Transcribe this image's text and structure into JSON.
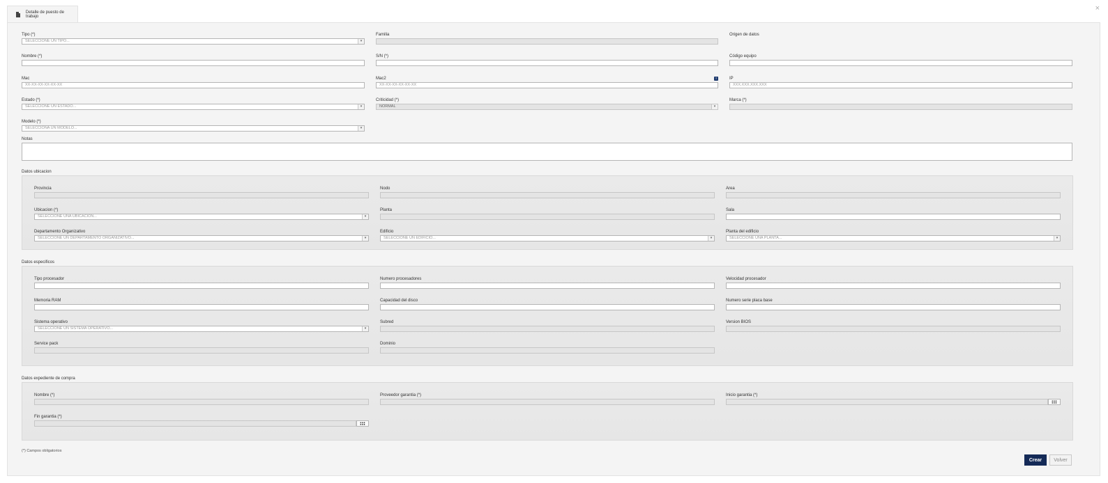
{
  "tab": {
    "title": "Detalle de puesto de trabajo",
    "icon": "document-icon"
  },
  "close_label": "×",
  "form": {
    "tipo": {
      "label": "Tipo (*)",
      "placeholder": "SELECCIONE UN TIPO..."
    },
    "familia": {
      "label": "Familia",
      "value": ""
    },
    "origen_datos": {
      "label": "Origen de datos"
    },
    "nombre": {
      "label": "Nombre (*)",
      "value": ""
    },
    "sn": {
      "label": "S/N (*)",
      "value": ""
    },
    "codigo_equipo": {
      "label": "Código equipo",
      "value": ""
    },
    "mac": {
      "label": "Mac",
      "placeholder": "XX-XX-XX-XX-XX-XX"
    },
    "mac2": {
      "label": "Mac2",
      "placeholder": "XX-XX-XX-XX-XX-XX",
      "info_icon": "info-icon"
    },
    "ip": {
      "label": "IP",
      "placeholder": "XXX.XXX.XXX.XXX"
    },
    "estado": {
      "label": "Estado (*)",
      "placeholder": "SELECCIONE UN ESTADO..."
    },
    "criticidad": {
      "label": "Criticidad (*)",
      "value": "NORMAL"
    },
    "marca": {
      "label": "Marca (*)",
      "value": ""
    },
    "modelo": {
      "label": "Modelo (*)",
      "placeholder": "SELECCIONA UN MODELO..."
    },
    "notas": {
      "label": "Notas",
      "value": ""
    }
  },
  "ubicacion": {
    "title": "Datos ubicacion",
    "provincia": {
      "label": "Provincia",
      "value": ""
    },
    "nodo": {
      "label": "Nodo",
      "value": ""
    },
    "area": {
      "label": "Area",
      "value": ""
    },
    "ubicacion": {
      "label": "Ubicacion (*)",
      "placeholder": "SELECCIONE UNA UBICACIÓN..."
    },
    "planta": {
      "label": "Planta",
      "value": ""
    },
    "sala": {
      "label": "Sala",
      "value": ""
    },
    "departamento": {
      "label": "Departamento Organizativo",
      "placeholder": "SELECCIONE UN DEPARTAMENTO ORGANIZATIVO..."
    },
    "edificio": {
      "label": "Edificio",
      "placeholder": "SELECCIONE UN EDIFICIO..."
    },
    "planta_edificio": {
      "label": "Planta del edificio",
      "placeholder": "SELECCIONE UNA PLANTA..."
    }
  },
  "especificos": {
    "title": "Datos especificos",
    "tipo_procesador": {
      "label": "Tipo procesador",
      "value": ""
    },
    "numero_procesadores": {
      "label": "Numero procesadores",
      "value": ""
    },
    "velocidad_procesador": {
      "label": "Velocidad procesador",
      "value": ""
    },
    "memoria_ram": {
      "label": "Memoria RAM",
      "value": ""
    },
    "capacidad_disco": {
      "label": "Capacidad del disco",
      "value": ""
    },
    "numero_serie_placa": {
      "label": "Numero serie placa base",
      "value": ""
    },
    "sistema_operativo": {
      "label": "Sistema operativo",
      "placeholder": "SELECCIONE UN SISTEMA OPERATIVO..."
    },
    "subred": {
      "label": "Subred",
      "value": ""
    },
    "version_bios": {
      "label": "Version BIOS",
      "value": ""
    },
    "service_pack": {
      "label": "Service pack",
      "value": ""
    },
    "dominio": {
      "label": "Dominio",
      "value": ""
    }
  },
  "compra": {
    "title": "Datos expediente de compra",
    "nombre": {
      "label": "Nombre (*)",
      "value": ""
    },
    "proveedor_garantia": {
      "label": "Proveedor garantia (*)",
      "value": ""
    },
    "inicio_garantia": {
      "label": "Inicio garantia (*)",
      "value": ""
    },
    "fin_garantia": {
      "label": "Fin garantia (*)",
      "value": ""
    }
  },
  "footnote": "(*) Campos obligatorios",
  "buttons": {
    "crear": "Crear",
    "volver": "Volver"
  }
}
